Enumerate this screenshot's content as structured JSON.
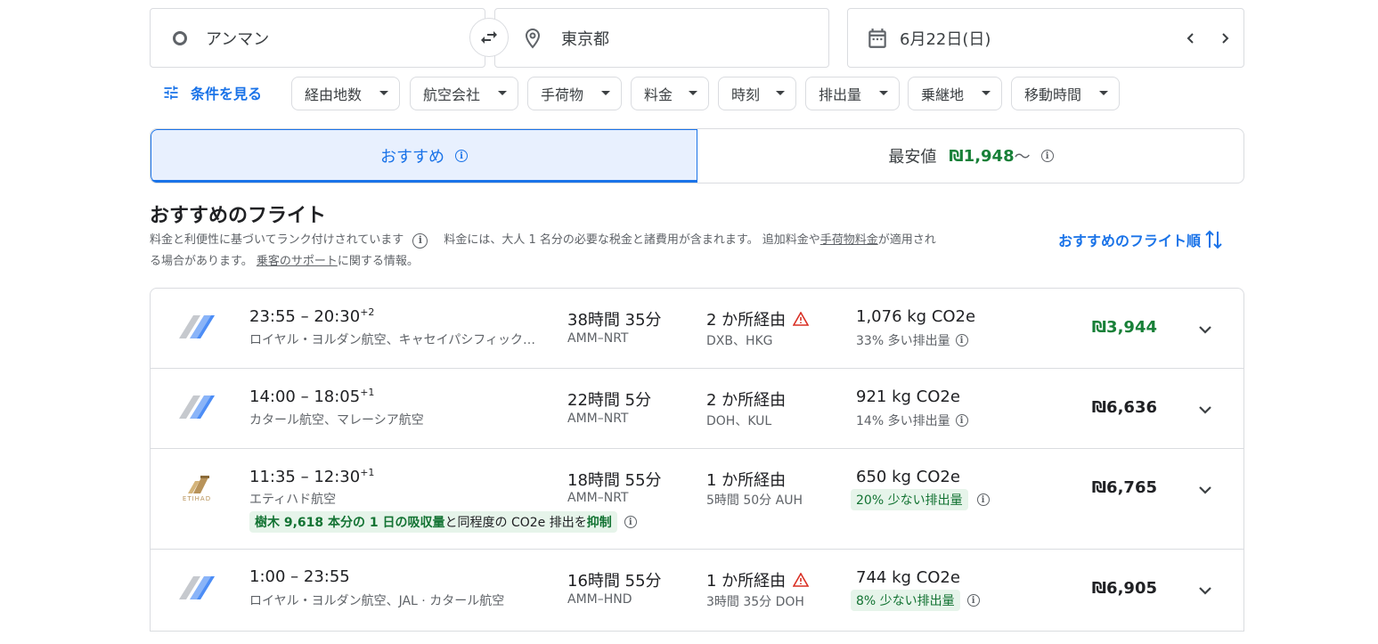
{
  "search": {
    "origin": "アンマン",
    "destination": "東京都",
    "date": "6月22日(日)"
  },
  "filters": {
    "show_conditions": "条件を見る",
    "chips": [
      "経由地数",
      "航空会社",
      "手荷物",
      "料金",
      "時刻",
      "排出量",
      "乗継地",
      "移動時間"
    ]
  },
  "tabs": {
    "best": "おすすめ",
    "cheapest": "最安値",
    "cheapest_price": "₪1,948",
    "cheapest_suffix": "〜"
  },
  "section": {
    "title": "おすすめのフライト",
    "desc_1": "料金と利便性に基づいてランク付けされています",
    "desc_2": "料金には、大人 1 名分の必要な税金と諸費用が含まれます。 追加料金や",
    "desc_link_1": "手荷物料金",
    "desc_3": "が適用され",
    "desc_4": "る場合があります。 ",
    "desc_link_2": "乗客のサポート",
    "desc_5": "に関する情報。",
    "sort_label": "おすすめのフライト順"
  },
  "flights": [
    {
      "times": "23:55 – 20:30",
      "day_offset": "+2",
      "airline": "ロイヤル・ヨルダン航空、キャセイパシフィック航空",
      "duration": "38時間 35分",
      "route": "AMM–NRT",
      "stops": "2 か所経由",
      "via": "DXB、HKG",
      "co2": "1,076 kg CO2e",
      "emissions": "33% 多い排出量",
      "price": "₪3,944"
    },
    {
      "times": "14:00 – 18:05",
      "day_offset": "+1",
      "airline": "カタール航空、マレーシア航空",
      "duration": "22時間 5分",
      "route": "AMM–NRT",
      "stops": "2 か所経由",
      "via": "DOH、KUL",
      "co2": "921 kg CO2e",
      "emissions": "14% 多い排出量",
      "price": "₪6,636"
    },
    {
      "times": "11:35 – 12:30",
      "day_offset": "+1",
      "airline": "エティハド航空",
      "duration": "18時間 55分",
      "route": "AMM–NRT",
      "stops": "1 か所経由",
      "via": "5時間 50分 AUH",
      "co2": "650 kg CO2e",
      "emissions": "20% 少ない排出量",
      "price": "₪6,765",
      "logo_text": "ETIHAD",
      "eco_1": "樹木 9,618 本分の 1 日の吸収量",
      "eco_2": "と同程度の CO2e 排出を",
      "eco_3": "抑制"
    },
    {
      "times": "1:00 – 23:55",
      "day_offset": "",
      "airline": "ロイヤル・ヨルダン航空、JAL · カタール航空",
      "duration": "16時間 55分",
      "route": "AMM–HND",
      "stops": "1 か所経由",
      "via": "3時間 35分 DOH",
      "co2": "744 kg CO2e",
      "emissions": "8% 少ない排出量",
      "price": "₪6,905"
    }
  ],
  "colors": {
    "accent": "#1a73e8",
    "price_green": "#188038",
    "eco_bg": "#e6f4ea",
    "warning": "#d93025"
  }
}
